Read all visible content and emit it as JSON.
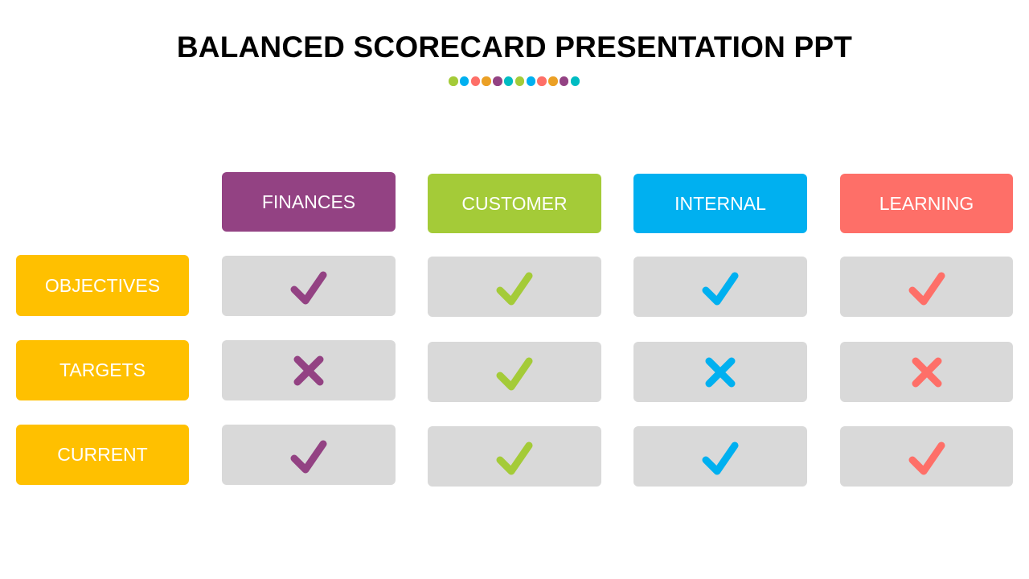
{
  "title": "BALANCED SCORECARD PRESENTATION PPT",
  "dots": [
    "#a4cb38",
    "#00b0f0",
    "#fe6f68",
    "#eba025",
    "#934283",
    "#00bcc2",
    "#a4cb38",
    "#00b0f0",
    "#fe6f68",
    "#eba025",
    "#934283",
    "#00bcc2"
  ],
  "row_label_color": "#ffc000",
  "cell_bg": "#d9d9d9",
  "columns": [
    {
      "label": "FINANCES",
      "color": "#934283"
    },
    {
      "label": "CUSTOMER",
      "color": "#a4cb38"
    },
    {
      "label": "INTERNAL",
      "color": "#00b0f0"
    },
    {
      "label": "LEARNING",
      "color": "#fe6f68"
    }
  ],
  "rows": [
    {
      "label": "OBJECTIVES",
      "marks": [
        "check-icon",
        "check-icon",
        "check-icon",
        "check-icon"
      ]
    },
    {
      "label": "TARGETS",
      "marks": [
        "cross-icon",
        "check-icon",
        "cross-icon",
        "cross-icon"
      ]
    },
    {
      "label": "CURRENT",
      "marks": [
        "check-icon",
        "check-icon",
        "check-icon",
        "check-icon"
      ]
    }
  ]
}
